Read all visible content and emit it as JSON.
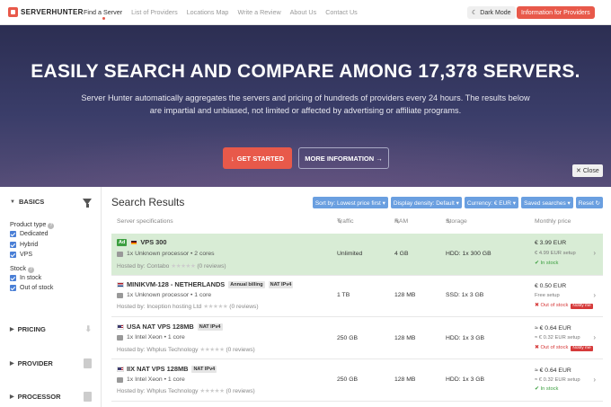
{
  "nav": {
    "logo": "SERVERHUNTER",
    "links": [
      "Find a Server",
      "List of Providers",
      "Locations Map",
      "Write a Review",
      "About Us",
      "Contact Us"
    ],
    "dark_mode": "Dark Mode",
    "providers_button": "Information for Providers"
  },
  "hero": {
    "title": "EASILY SEARCH AND COMPARE AMONG 17,378 SERVERS.",
    "description": "Server Hunter automatically aggregates the servers and pricing of hundreds of providers every 24 hours. The results below are impartial and unbiased, not limited or affected by advertising or affiliate programs.",
    "get_started": "GET STARTED",
    "more_info": "MORE INFORMATION →",
    "close": "Close"
  },
  "sidebar": {
    "basics": "BASICS",
    "product_type": "Product type",
    "product_types": [
      "Dedicated",
      "Hybrid",
      "VPS"
    ],
    "stock": "Stock",
    "stock_options": [
      "In stock",
      "Out of stock"
    ],
    "pricing": "PRICING",
    "provider": "PROVIDER",
    "processor": "PROCESSOR"
  },
  "results": {
    "title": "Search Results",
    "controls": [
      "Sort by: Lowest price first ▾",
      "Display density: Default ▾",
      "Currency: € EUR ▾",
      "Saved searches ▾",
      "Reset ↻"
    ],
    "headers": {
      "specs": "Server specifications",
      "traffic": "Traffic",
      "ram": "RAM",
      "storage": "Storage",
      "price": "Monthly price"
    },
    "rows": [
      {
        "ad": "Ad",
        "flag": "de",
        "name": "VPS 300",
        "badges": [],
        "processor": "1x Unknown processor • 2 cores",
        "host": "Hosted by: Contabo",
        "reviews": "(0 reviews)",
        "traffic": "Unlimited",
        "ram": "4 GB",
        "storage": "HDD: 1x 300 GB",
        "price": "€ 3.99 EUR",
        "setup": "€ 4.99 EUR setup",
        "stock": "In stock",
        "notify": ""
      },
      {
        "ad": "",
        "flag": "nl",
        "name": "MINIKVM-128 - NETHERLANDS",
        "badges": [
          "Annual billing",
          "NAT IPv4"
        ],
        "processor": "1x Unknown processor • 1 core",
        "host": "Hosted by: Inception hosting Ltd",
        "reviews": "(0 reviews)",
        "traffic": "1 TB",
        "ram": "128 MB",
        "storage": "SSD: 1x 3 GB",
        "price": "€ 0.50 EUR",
        "setup": "Free setup",
        "stock": "Out of stock",
        "notify": "Notify me"
      },
      {
        "ad": "",
        "flag": "us",
        "name": "USA NAT VPS 128MB",
        "badges": [
          "NAT IPv4"
        ],
        "processor": "1x Intel Xeon • 1 core",
        "host": "Hosted by: Whplus Technology",
        "reviews": "(0 reviews)",
        "traffic": "250 GB",
        "ram": "128 MB",
        "storage": "HDD: 1x 3 GB",
        "price": "≈ € 0.64 EUR",
        "setup": "≈ € 0.32 EUR setup",
        "stock": "Out of stock",
        "notify": "Notify me"
      },
      {
        "ad": "",
        "flag": "us",
        "name": "IIX NAT VPS 128MB",
        "badges": [
          "NAT IPv4"
        ],
        "processor": "1x Intel Xeon • 1 core",
        "host": "Hosted by: Whplus Technology",
        "reviews": "(0 reviews)",
        "traffic": "250 GB",
        "ram": "128 MB",
        "storage": "HDD: 1x 3 GB",
        "price": "≈ € 0.64 EUR",
        "setup": "≈ € 0.32 EUR setup",
        "stock": "In stock",
        "notify": ""
      }
    ]
  },
  "colors": {
    "accent": "#e8594a",
    "blue": "#6a9fe0",
    "highlight_row": "#d8ecd5",
    "hero_bg": "#3a3d69"
  }
}
